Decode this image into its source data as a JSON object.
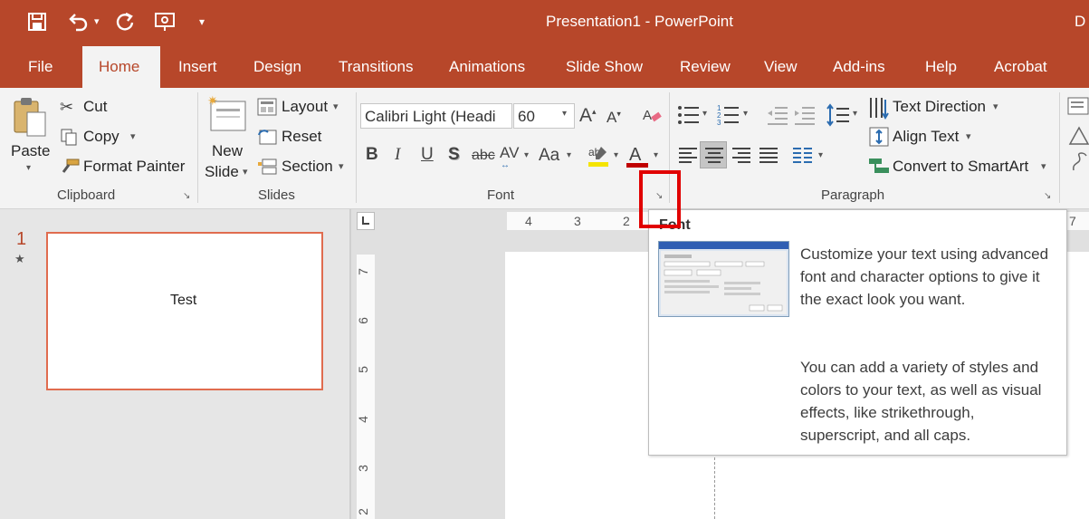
{
  "window": {
    "title": "Presentation1  -  PowerPoint",
    "corner_text": "D"
  },
  "qat": {
    "save_icon": "save-icon",
    "undo_icon": "undo-icon",
    "redo_icon": "repeat-icon",
    "present_icon": "presenter-icon",
    "customize_icon": "dropdown-icon"
  },
  "tabs": [
    "File",
    "Home",
    "Insert",
    "Design",
    "Transitions",
    "Animations",
    "Slide Show",
    "Review",
    "View",
    "Add-ins",
    "Help",
    "Acrobat"
  ],
  "clipboard": {
    "paste": "Paste",
    "cut": "Cut",
    "copy": "Copy",
    "format_painter": "Format Painter",
    "group": "Clipboard"
  },
  "slides": {
    "new_slide_1": "New",
    "new_slide_2": "Slide",
    "layout": "Layout",
    "reset": "Reset",
    "section": "Section",
    "group": "Slides"
  },
  "font": {
    "name": "Calibri Light (Headi",
    "size": "60",
    "group": "Font",
    "bold": "B",
    "italic": "I",
    "underline": "U",
    "shadow": "S",
    "strike": "abc",
    "spacing": "AV",
    "case": "Aa"
  },
  "paragraph": {
    "text_direction": "Text Direction",
    "align_text": "Align Text",
    "smartart": "Convert to SmartArt",
    "group": "Paragraph"
  },
  "slide_pane": {
    "number": "1",
    "star": "★",
    "thumb_text": "Test"
  },
  "ruler": {
    "h": [
      "4",
      "3",
      "2"
    ],
    "h_right": "7",
    "v": [
      "7",
      "6",
      "5",
      "4",
      "3",
      "2"
    ]
  },
  "tooltip": {
    "title": "Font",
    "p1": "Customize your text using advanced font and character options to give it the exact look you want.",
    "p2": "You can add a variety of styles and colors to your text, as well as visual effects, like strikethrough, superscript, and all caps."
  },
  "colors": {
    "accent": "#b7472a",
    "highlight_box": "#e10000",
    "thumb_border": "#e06c4f"
  }
}
